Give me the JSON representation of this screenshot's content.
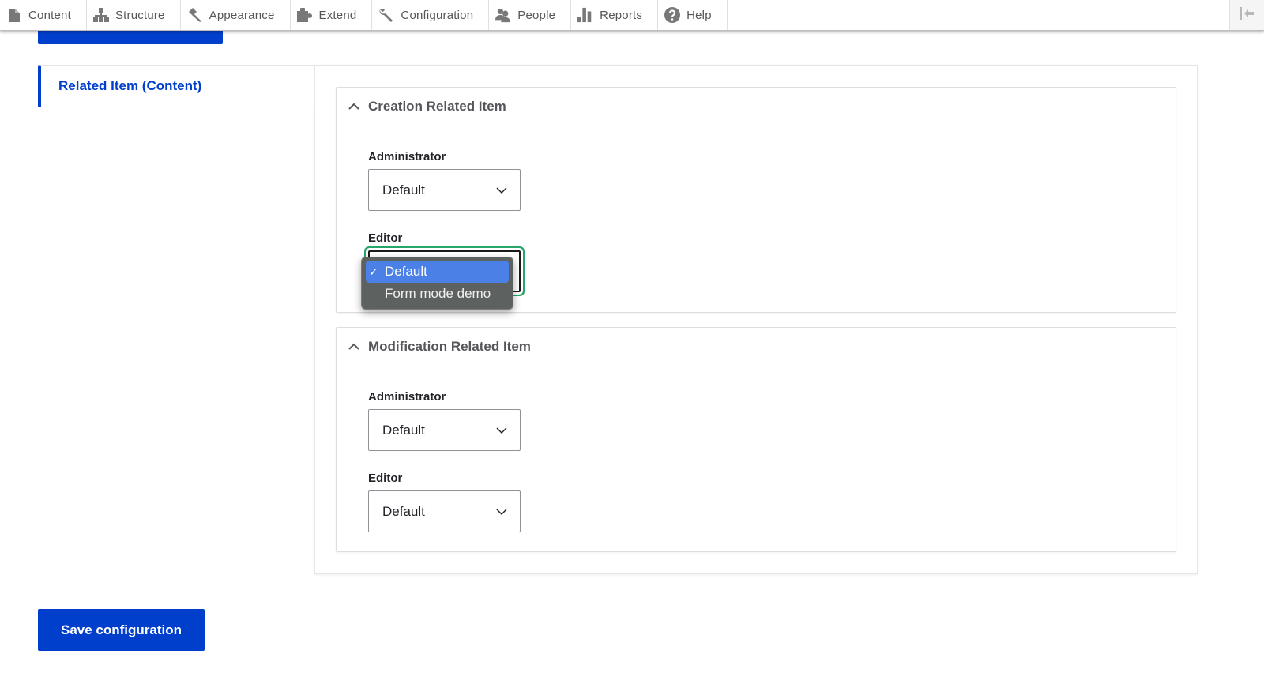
{
  "toolbar": {
    "items": [
      {
        "label": "Content",
        "icon": "file-icon"
      },
      {
        "label": "Structure",
        "icon": "sitemap-icon"
      },
      {
        "label": "Appearance",
        "icon": "paintbrush-icon"
      },
      {
        "label": "Extend",
        "icon": "puzzle-icon"
      },
      {
        "label": "Configuration",
        "icon": "wrench-icon"
      },
      {
        "label": "People",
        "icon": "people-icon"
      },
      {
        "label": "Reports",
        "icon": "bar-chart-icon"
      },
      {
        "label": "Help",
        "icon": "help-icon"
      }
    ],
    "collapse_icon": "collapse-left-icon"
  },
  "vertical_tabs": {
    "active_tab": "Related Item (Content)"
  },
  "sections": [
    {
      "title": "Creation Related Item",
      "expanded": true,
      "fields": [
        {
          "label": "Administrator",
          "value": "Default"
        },
        {
          "label": "Editor",
          "value": "Default",
          "open": true
        }
      ]
    },
    {
      "title": "Modification Related Item",
      "expanded": true,
      "fields": [
        {
          "label": "Administrator",
          "value": "Default"
        },
        {
          "label": "Editor",
          "value": "Default"
        }
      ]
    }
  ],
  "dropdown": {
    "options": [
      {
        "label": "Default",
        "selected": true,
        "check": "✓"
      },
      {
        "label": "Form mode demo",
        "selected": false
      }
    ]
  },
  "actions": {
    "save_label": "Save configuration"
  },
  "colors": {
    "primary": "#003ecc",
    "focus": "#26a769",
    "dropdown_bg": "#5d615f",
    "dropdown_selected": "#4b80e7"
  }
}
